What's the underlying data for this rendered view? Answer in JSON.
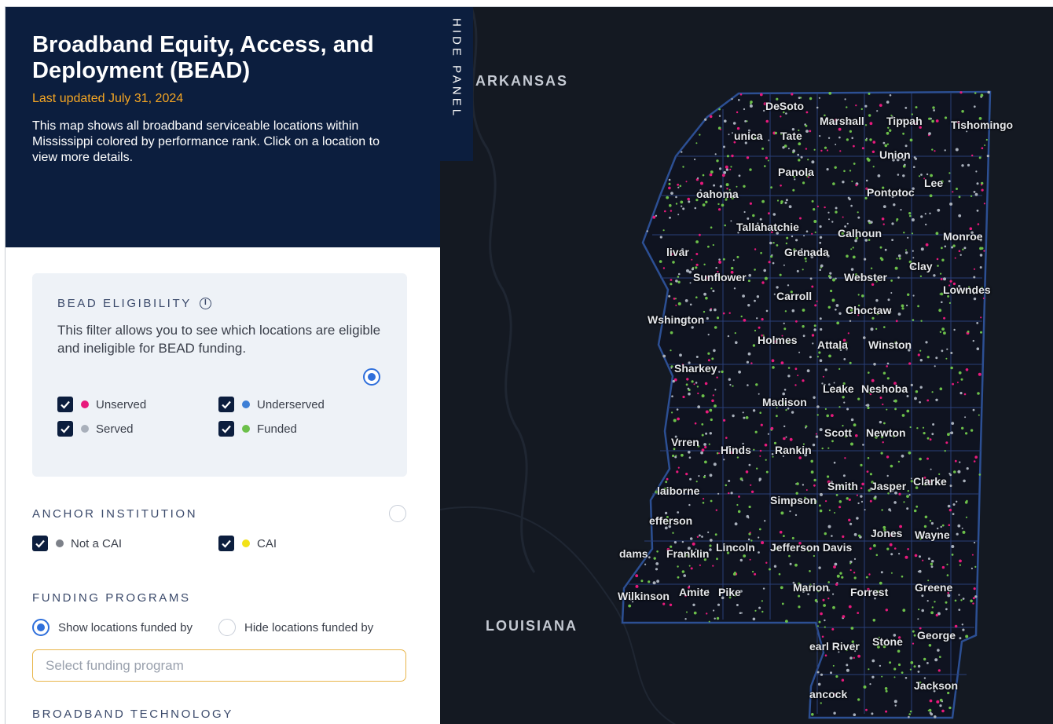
{
  "panel": {
    "title": "Broadband Equity, Access, and Deployment (BEAD)",
    "updated": "Last updated July 31, 2024",
    "description": "This map shows all broadband serviceable locations within Mississippi colored by performance rank. Click on a location to view more details.",
    "hide_label": "HIDE PANEL"
  },
  "bead": {
    "title": "BEAD ELIGIBILITY",
    "info_icon": "ⓘ",
    "description": "This filter allows you to see which locations are eligible and ineligible for BEAD funding.",
    "selected": true,
    "filters": [
      {
        "label": "Unserved",
        "checked": true,
        "color": "#e8197c"
      },
      {
        "label": "Underserved",
        "checked": true,
        "color": "#3d7fd6"
      },
      {
        "label": "Served",
        "checked": true,
        "color": "#a9b0bb"
      },
      {
        "label": "Funded",
        "checked": true,
        "color": "#6cc04a"
      }
    ]
  },
  "anchor": {
    "title": "ANCHOR INSTITUTION",
    "selected": false,
    "filters": [
      {
        "label": "Not a CAI",
        "checked": true,
        "color": "#7d8189"
      },
      {
        "label": "CAI",
        "checked": true,
        "color": "#f2e218"
      }
    ]
  },
  "funding": {
    "title": "FUNDING PROGRAMS",
    "options": [
      {
        "label": "Show locations funded by",
        "selected": true
      },
      {
        "label": "Hide locations funded by",
        "selected": false
      }
    ],
    "select_placeholder": "Select funding program"
  },
  "tech": {
    "title": "BROADBAND TECHNOLOGY"
  },
  "map": {
    "states": [
      "ARKANSAS",
      "LOUISIANA"
    ],
    "counties": [
      "DeSoto",
      "Marshall",
      "Tippah",
      "Tishomingo",
      "unica",
      "Tate",
      "Union",
      "Panola",
      "Lee",
      "Pontotoc",
      "oahoma",
      "Tallahatchie",
      "Calhoun",
      "Monroe",
      "livar",
      "Grenada",
      "Clay",
      "Sunflower",
      "Webster",
      "Lowndes",
      "Carroll",
      "Choctaw",
      "Wshington",
      "Holmes",
      "Attala",
      "Winston",
      "Sharkey",
      "Leake",
      "Neshoba",
      "Madison",
      "Scott",
      "Newton",
      "Vrren",
      "Hinds",
      "Rankin",
      "Smith",
      "Jasper",
      "Clarke",
      "laiborne",
      "Simpson",
      "efferson",
      "Jones",
      "Wayne",
      "dams",
      "Franklin",
      "Lincoln",
      "Jefferson Davis",
      "Wilkinson",
      "Amite",
      "Pike",
      "Marion",
      "Forrest",
      "Greene",
      "earl River",
      "Stone",
      "George",
      "ancock",
      "Jackson"
    ]
  }
}
